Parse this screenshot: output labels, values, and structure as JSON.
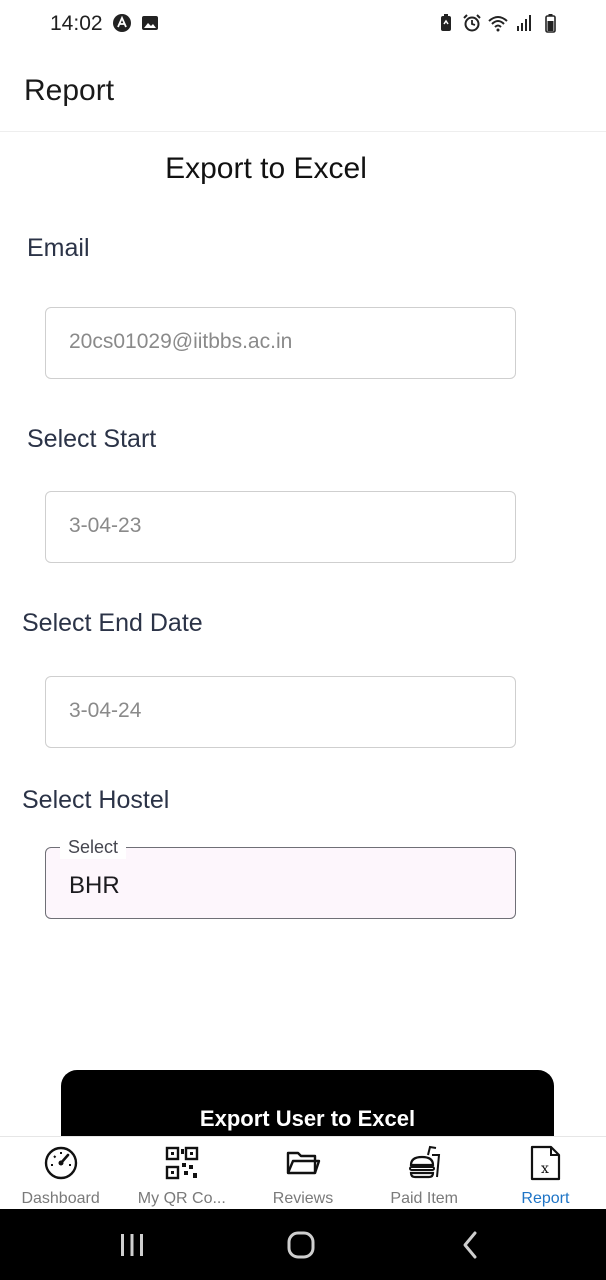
{
  "status_bar": {
    "time": "14:02"
  },
  "app_bar": {
    "title": "Report"
  },
  "form": {
    "heading": "Export to Excel",
    "email": {
      "label": "Email",
      "value": "20cs01029@iitbbs.ac.in"
    },
    "start": {
      "label": "Select Start",
      "value": "3-04-23"
    },
    "end": {
      "label": "Select End Date",
      "value": "3-04-24"
    },
    "hostel": {
      "label": "Select Hostel",
      "legend": "Select",
      "value": "BHR"
    },
    "submit_label": "Export User to Excel"
  },
  "bottom_nav": {
    "items": [
      {
        "label": "Dashboard",
        "icon": "speedometer-icon"
      },
      {
        "label": "My QR Co...",
        "icon": "qr-code-icon"
      },
      {
        "label": "Reviews",
        "icon": "folder-icon"
      },
      {
        "label": "Paid Item",
        "icon": "burger-drink-icon"
      },
      {
        "label": "Report",
        "icon": "excel-file-icon"
      }
    ],
    "active_index": 4
  },
  "colors": {
    "active_nav": "#1e74c6",
    "button_bg": "#000000",
    "select_bg": "#fdf6fc",
    "label_color": "#2b3347"
  }
}
